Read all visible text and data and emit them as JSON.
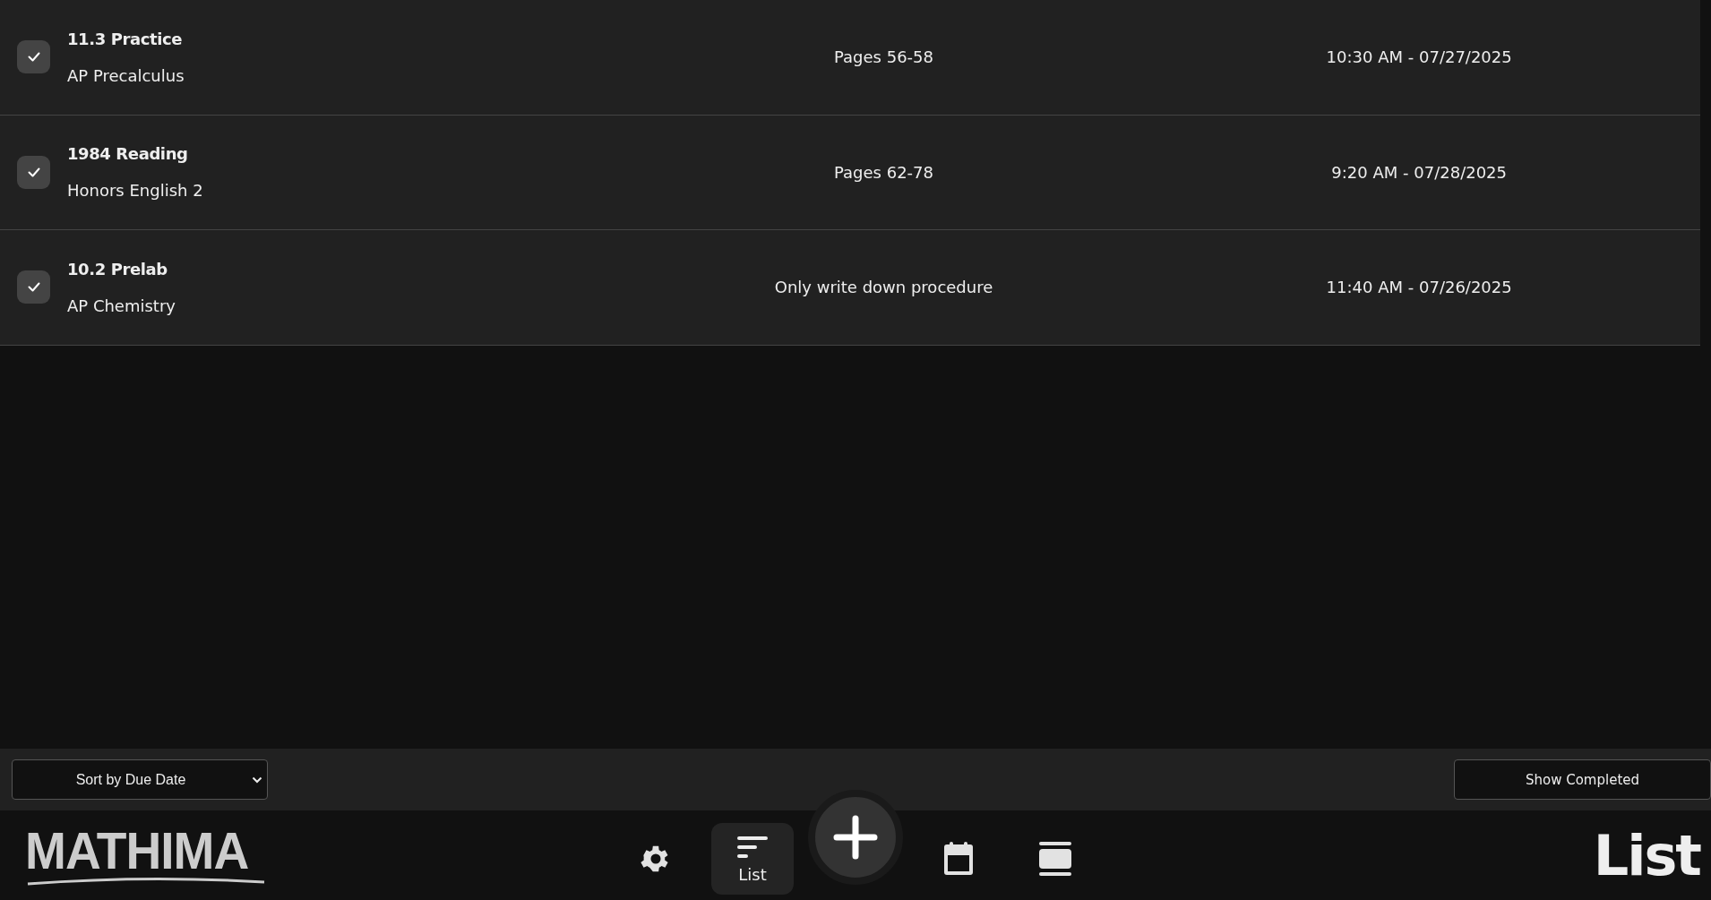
{
  "tasks": [
    {
      "title": "11.3 Practice",
      "course": "AP Precalculus",
      "note": "Pages 56-58",
      "due": "10:30 AM - 07/27/2025",
      "checked": true
    },
    {
      "title": "1984 Reading",
      "course": "Honors English 2",
      "note": "Pages 62-78",
      "due": "9:20 AM - 07/28/2025",
      "checked": true
    },
    {
      "title": "10.2 Prelab",
      "course": "AP Chemistry",
      "note": "Only write down procedure",
      "due": "11:40 AM - 07/26/2025",
      "checked": true
    }
  ],
  "toolbar": {
    "sort": {
      "value": "Sort by Due Date"
    },
    "show_completed": "Show Completed"
  },
  "logo": "MATHIMA",
  "nav": [
    {
      "kind": "settings",
      "selected": false
    },
    {
      "kind": "list",
      "selected": true,
      "label": "List"
    },
    {
      "kind": "add",
      "selected": false
    },
    {
      "kind": "calendar",
      "selected": false
    },
    {
      "kind": "cards",
      "selected": false
    }
  ],
  "page_title": "List"
}
